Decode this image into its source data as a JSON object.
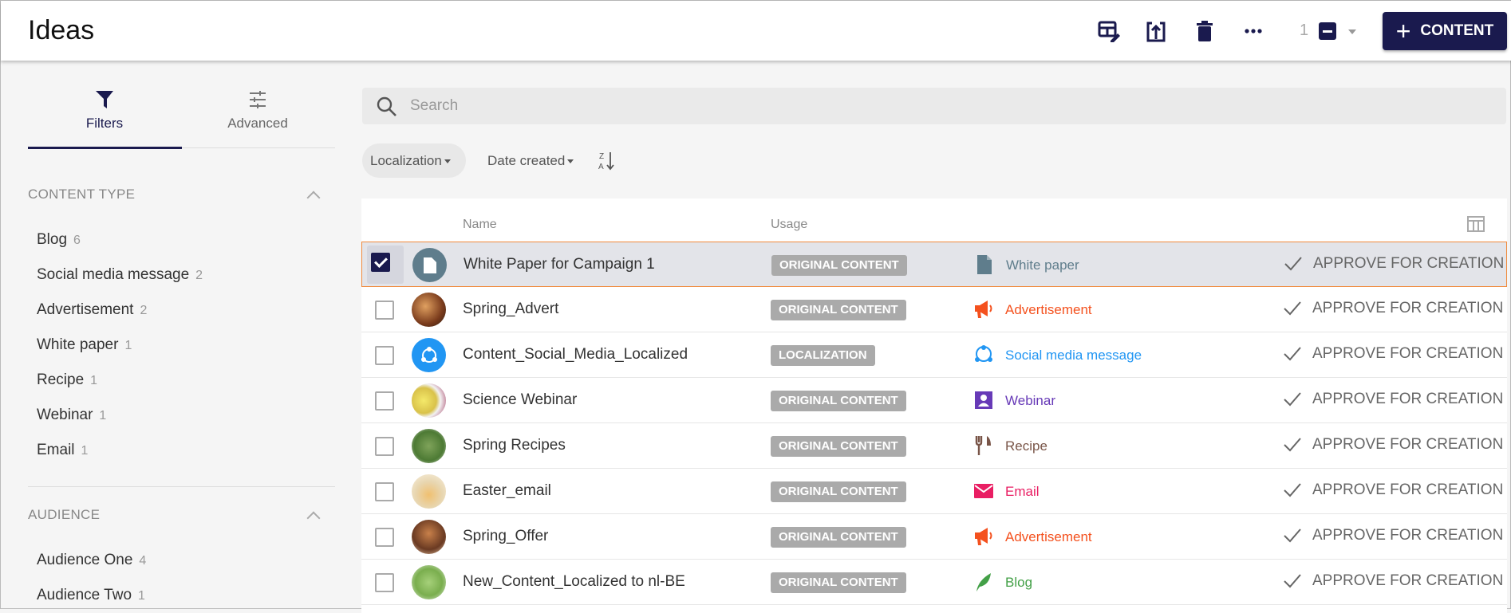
{
  "header": {
    "title": "Ideas",
    "count": "1",
    "content_button": "CONTENT"
  },
  "sidebar": {
    "tabs": [
      {
        "label": "Filters"
      },
      {
        "label": "Advanced"
      }
    ],
    "content_type": {
      "title": "CONTENT TYPE",
      "items": [
        {
          "label": "Blog",
          "count": "6"
        },
        {
          "label": "Social media message",
          "count": "2"
        },
        {
          "label": "Advertisement",
          "count": "2"
        },
        {
          "label": "White paper",
          "count": "1"
        },
        {
          "label": "Recipe",
          "count": "1"
        },
        {
          "label": "Webinar",
          "count": "1"
        },
        {
          "label": "Email",
          "count": "1"
        }
      ]
    },
    "audience": {
      "title": "AUDIENCE",
      "items": [
        {
          "label": "Audience One",
          "count": "4"
        },
        {
          "label": "Audience Two",
          "count": "1"
        }
      ]
    }
  },
  "search": {
    "placeholder": "Search"
  },
  "filters": {
    "localization": "Localization",
    "date_created": "Date created"
  },
  "table": {
    "headers": {
      "name": "Name",
      "usage": "Usage"
    },
    "rows": [
      {
        "name": "White Paper for Campaign 1",
        "usage": "ORIGINAL CONTENT",
        "type": "White paper",
        "type_icon": "document-icon",
        "color": "#5f7d8c",
        "action": "APPROVE FOR CREATION",
        "selected": true
      },
      {
        "name": "Spring_Advert",
        "usage": "ORIGINAL CONTENT",
        "type": "Advertisement",
        "type_icon": "megaphone-icon",
        "color": "#f4511e",
        "action": "APPROVE FOR CREATION"
      },
      {
        "name": "Content_Social_Media_Localized",
        "usage": "LOCALIZATION",
        "type": "Social media message",
        "type_icon": "share-icon",
        "color": "#2196f3",
        "action": "APPROVE FOR CREATION"
      },
      {
        "name": "Science Webinar",
        "usage": "ORIGINAL CONTENT",
        "type": "Webinar",
        "type_icon": "webinar-icon",
        "color": "#673ab7",
        "action": "APPROVE FOR CREATION"
      },
      {
        "name": "Spring Recipes",
        "usage": "ORIGINAL CONTENT",
        "type": "Recipe",
        "type_icon": "fork-knife-icon",
        "color": "#795548",
        "action": "APPROVE FOR CREATION"
      },
      {
        "name": "Easter_email",
        "usage": "ORIGINAL CONTENT",
        "type": "Email",
        "type_icon": "envelope-icon",
        "color": "#e91e63",
        "action": "APPROVE FOR CREATION"
      },
      {
        "name": "Spring_Offer",
        "usage": "ORIGINAL CONTENT",
        "type": "Advertisement",
        "type_icon": "megaphone-icon",
        "color": "#f4511e",
        "action": "APPROVE FOR CREATION"
      },
      {
        "name": "New_Content_Localized to nl-BE",
        "usage": "ORIGINAL CONTENT",
        "type": "Blog",
        "type_icon": "feather-icon",
        "color": "#43a047",
        "action": "APPROVE FOR CREATION"
      }
    ]
  }
}
